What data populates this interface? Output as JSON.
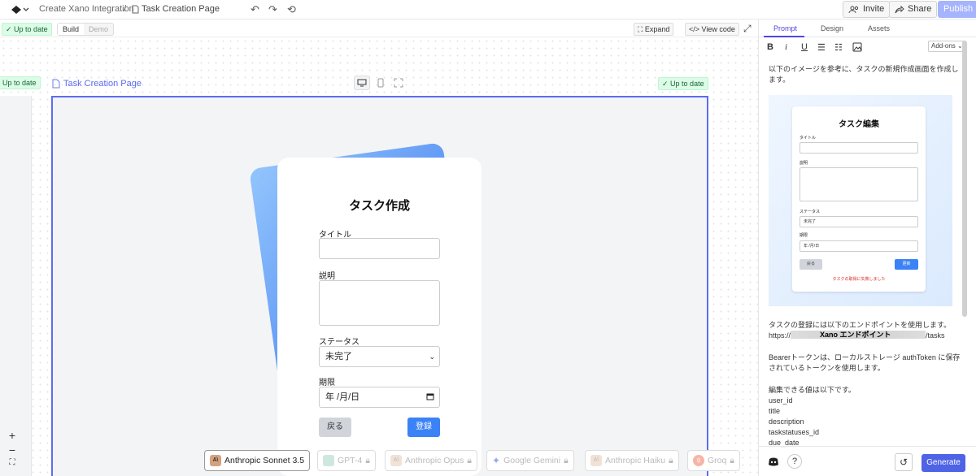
{
  "header": {
    "breadcrumb": [
      "Create Xano Integration",
      "/",
      "Task Creation Page"
    ],
    "invite": "Invite",
    "share": "Share",
    "publish": "Publish"
  },
  "toolbar": {
    "status": "Up to date",
    "tab_build": "Build",
    "tab_demo": "Demo",
    "expand": "Expand",
    "view_code": "View code"
  },
  "canvas": {
    "left_status": "Up to date",
    "page_name": "Task Creation Page",
    "frame_status": "Up to date"
  },
  "form": {
    "title": "タスク作成",
    "title_label": "タイトル",
    "desc_label": "説明",
    "status_label": "ステータス",
    "status_value": "未完了",
    "due_label": "期限",
    "due_placeholder": "年 /月/日",
    "back": "戻る",
    "register": "登録"
  },
  "models": [
    "Anthropic Sonnet 3.5",
    "GPT-4",
    "Anthropic Opus",
    "Google Gemini",
    "Anthropic Haiku",
    "Groq"
  ],
  "right_panel": {
    "tabs": [
      "Prompt",
      "Design",
      "Assets"
    ],
    "addons": "Add-ons",
    "intro": "以下のイメージを参考に、タスクの新規作成画面を作成します。",
    "preview": {
      "title": "タスク編集",
      "title_label": "タイトル",
      "desc_label": "説明",
      "status_label": "ステータス",
      "status_value": "未完了",
      "due_label": "期限",
      "due_placeholder": "年 /月/日",
      "back": "戻る",
      "update": "更新",
      "error": "タスクの取得に失敗しました"
    },
    "endpoint_line1": "タスクの登録には以下のエンドポイントを使用します。",
    "endpoint_prefix": "https://",
    "endpoint_label": "Xano エンドポイント",
    "endpoint_suffix": "/tasks",
    "bearer": "Bearerトークンは、ローカルストレージ authToken に保存されているトークンを使用します。",
    "editable_intro": "編集できる値は以下です。",
    "fields": [
      "user_id",
      "title",
      "description",
      "taskstatuses_id",
      "due_date"
    ],
    "generate": "Generate"
  }
}
